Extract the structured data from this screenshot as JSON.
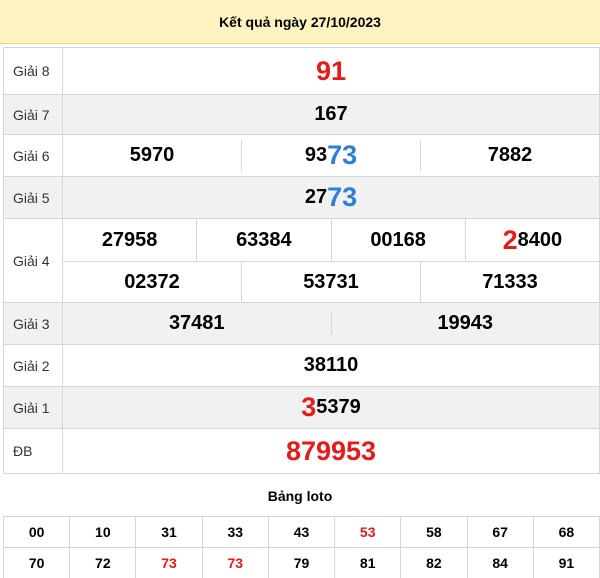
{
  "header": {
    "title": "Kết quả ngày 27/10/2023"
  },
  "colors": {
    "red": "#e21b1b",
    "blue": "#2e7fd8",
    "header_bg": "#fff4c1"
  },
  "prizes": {
    "g8": {
      "label": "Giải 8",
      "value": "91"
    },
    "g7": {
      "label": "Giải 7",
      "value": "167"
    },
    "g6": {
      "label": "Giải 6",
      "values": [
        "5970",
        "93",
        "73",
        "7882"
      ]
    },
    "g5": {
      "label": "Giải 5",
      "prefix": "27",
      "suffix": "73"
    },
    "g4": {
      "label": "Giải 4",
      "row1": [
        "27958",
        "63384",
        "00168",
        "2",
        "8400"
      ],
      "row2": [
        "02372",
        "53731",
        "71333"
      ]
    },
    "g3": {
      "label": "Giải 3",
      "values": [
        "37481",
        "19943"
      ]
    },
    "g2": {
      "label": "Giải 2",
      "value": "38110"
    },
    "g1": {
      "label": "Giải 1",
      "first": "3",
      "rest": "5379"
    },
    "db": {
      "label": "ĐB",
      "value": "879953"
    }
  },
  "loto": {
    "title": "Bảng loto",
    "row1": [
      "00",
      "10",
      "31",
      "33",
      "43",
      "53",
      "58",
      "67",
      "68"
    ],
    "row2": [
      "70",
      "72",
      "73",
      "73",
      "79",
      "81",
      "82",
      "84",
      "91"
    ]
  }
}
